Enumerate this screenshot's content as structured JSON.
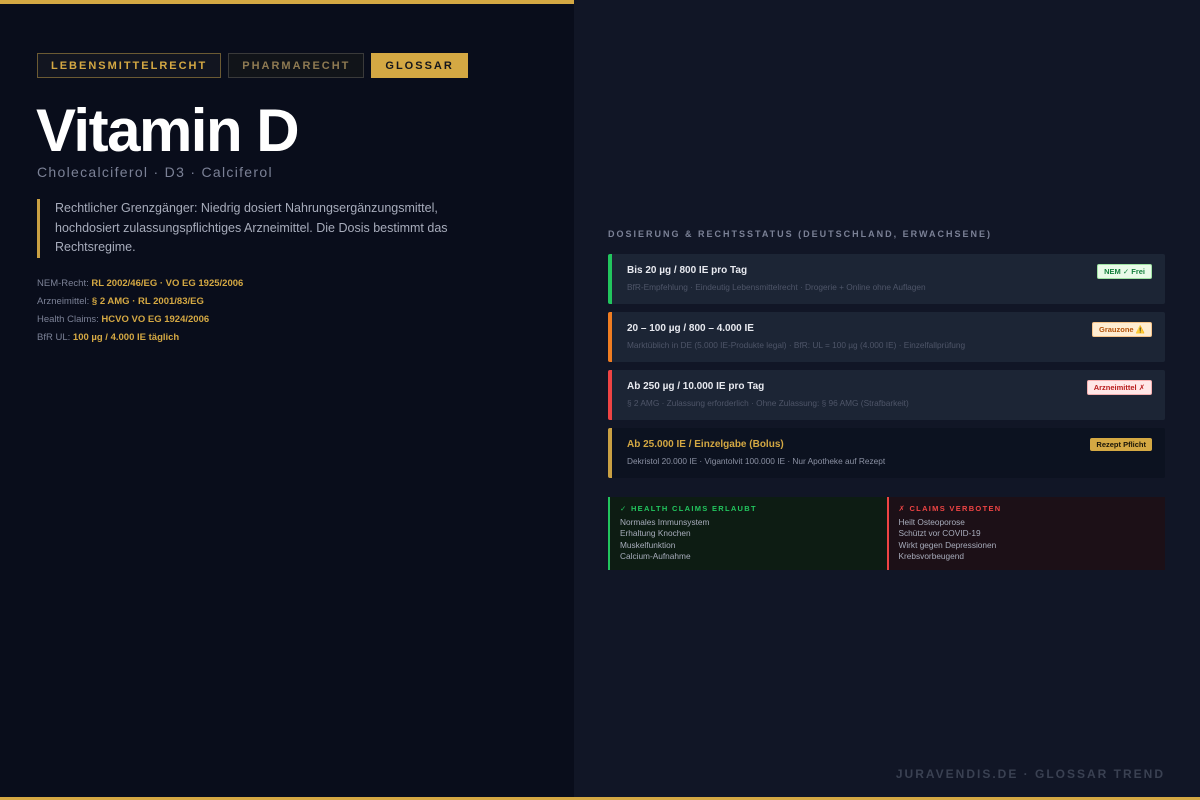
{
  "tabs": [
    {
      "label": "LEBENSMITTELRECHT"
    },
    {
      "label": "PHARMARECHT"
    },
    {
      "label": "GLOSSAR",
      "active": true
    }
  ],
  "title": "Vitamin D",
  "subtitle": "Cholecalciferol · D3 · Calciferol",
  "quote": "Rechtlicher Grenzgänger: Niedrig dosiert Nahrungsergänzungsmittel, hochdosiert zulassungspflichtiges Arzneimittel. Die Dosis bestimmt das Rechtsregime.",
  "references": [
    {
      "label": "NEM-Recht: ",
      "value": "RL 2002/46/EG · VO EG 1925/2006"
    },
    {
      "label": "Arzneimittel: ",
      "value": "§ 2 AMG · RL 2001/83/EG"
    },
    {
      "label": "Health Claims: ",
      "value": "HCVO VO EG 1924/2006"
    },
    {
      "label": "BfR UL: ",
      "value": "100 µg / 4.000 IE täglich"
    }
  ],
  "section_head": "DOSIERUNG & RECHTSSTATUS (DEUTSCHLAND, ERWACHSENE)",
  "dosage_cards": [
    {
      "title": "Bis 20 µg / 800 IE pro Tag",
      "desc": "BfR-Empfehlung · Eindeutig Lebensmittelrecht · Drogerie + Online ohne Auflagen",
      "badge": "NEM ✓ Frei",
      "color": "#22c55e"
    },
    {
      "title": "20 – 100 µg / 800 – 4.000 IE",
      "desc": "Marktüblich in DE (5.000 IE-Produkte legal) · BfR: UL = 100 µg (4.000 IE) · Einzelfallprüfung",
      "badge": "Grauzone ⚠️",
      "color": "#f07d22"
    },
    {
      "title": "Ab 250 µg / 10.000 IE pro Tag",
      "desc": "§ 2 AMG · Zulassung erforderlich · Ohne Zulassung: § 96 AMG (Strafbarkeit)",
      "badge": "Arzneimittel ✗",
      "color": "#ef4444"
    },
    {
      "title": "Ab 25.000 IE / Einzelgabe (Bolus)",
      "desc": "Dekristol 20.000 IE · Vigantolvit 100.000 IE · Nur Apotheke auf Rezept",
      "badge": "Rezept Pflicht",
      "color": "#c9a043"
    }
  ],
  "claims_allowed": {
    "head": "✓ HEALTH CLAIMS ERLAUBT",
    "items": [
      "Normales Immunsystem",
      "Erhaltung Knochen",
      "Muskelfunktion",
      "Calcium-Aufnahme"
    ]
  },
  "claims_forbidden": {
    "head": "✗ CLAIMS VERBOTEN",
    "items": [
      "Heilt Osteoporose",
      "Schützt vor COVID-19",
      "Wirkt gegen Depressionen",
      "Krebsvorbeugend"
    ]
  },
  "footer": "JURAVENDIS.DE · GLOSSAR TREND",
  "colors": {
    "accent": "#d4a843",
    "allowed": "#22c55e",
    "forbidden": "#ef4444",
    "gray_zone": "#f07d22"
  }
}
